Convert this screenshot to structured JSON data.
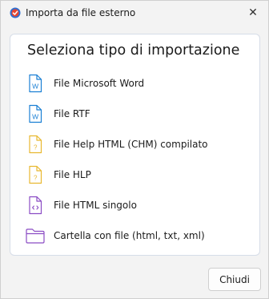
{
  "window": {
    "title": "Importa da file esterno",
    "close_glyph": "✕"
  },
  "panel": {
    "heading": "Seleziona tipo di importazione",
    "options": [
      {
        "label": "File Microsoft Word",
        "icon": "word-document-icon",
        "color": "#1a7fd4"
      },
      {
        "label": "File RTF",
        "icon": "rtf-document-icon",
        "color": "#1a7fd4"
      },
      {
        "label": "File Help HTML (CHM) compilato",
        "icon": "chm-help-file-icon",
        "color": "#e8b830"
      },
      {
        "label": "File HLP",
        "icon": "hlp-help-file-icon",
        "color": "#e8b830"
      },
      {
        "label": "File HTML singolo",
        "icon": "html-file-icon",
        "color": "#8b4cc4"
      },
      {
        "label": "Cartella con file (html, txt, xml)",
        "icon": "folder-icon",
        "color": "#8b4cc4"
      }
    ]
  },
  "footer": {
    "close_label": "Chiudi"
  }
}
